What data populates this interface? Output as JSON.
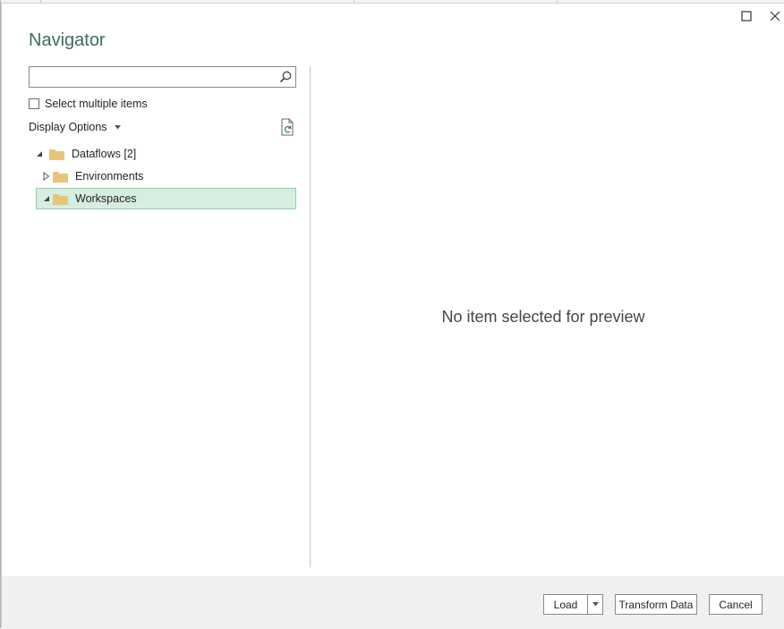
{
  "window": {
    "title": "Navigator"
  },
  "search": {
    "value": "",
    "placeholder": ""
  },
  "options": {
    "select_multiple_label": "Select multiple items",
    "select_multiple_checked": false,
    "display_options_label": "Display Options"
  },
  "tree": {
    "root": {
      "label": "Dataflows [2]",
      "expanded": true
    },
    "children": [
      {
        "label": "Environments",
        "expanded": false,
        "selected": false
      },
      {
        "label": "Workspaces",
        "expanded": true,
        "selected": true
      }
    ]
  },
  "preview": {
    "empty_message": "No item selected for preview"
  },
  "footer": {
    "load_label": "Load",
    "transform_label": "Transform Data",
    "cancel_label": "Cancel"
  },
  "colors": {
    "title": "#3c6e56",
    "selected_bg": "#d5eedf",
    "selected_border": "#8fcfa8",
    "folder": "#e8c47a",
    "footer_bg": "#f0f0f0"
  }
}
